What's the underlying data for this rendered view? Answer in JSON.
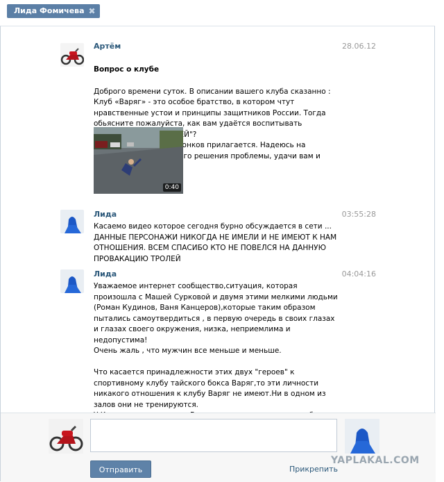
{
  "dialog_tab": {
    "name": "Лида Фомичева",
    "close": "✖"
  },
  "messages": [
    {
      "author": "Артём",
      "time": "28.06.12",
      "subject": "Вопрос о клубе",
      "text": "Доброго времени суток. В описании вашего клуба сказанно : Клуб «Варяг» - это особое братство, в котором чтут нравственные устои и принципы защитников России. Тогда обьясните пожалуйста, как вам удаётся воспитывать подобных \"ВЫКИДЫШЕЙ\"?\nВидео и ссылка на падонков прилагается. Надеюсь на понимание и скорейшего решения проблемы, удачи вам и вашему клубу.",
      "video_duration": "0:40"
    },
    {
      "author": "Лида",
      "time": "03:55:28",
      "text": "Касаемо видео которое сегодня бурно обсуждается в сети ...\nДАННЫЕ ПЕРСОНАЖИ НИКОГДА НЕ ИМЕЛИ И НЕ ИМЕЮТ К НАМ ОТНОШЕНИЯ. ВСЕМ СПАСИБО КТО НЕ ПОВЕЛСЯ НА ДАННУЮ ПРОВАКАЦИЮ ТРОЛЕЙ"
    },
    {
      "author": "Лида",
      "time": "04:04:16",
      "text": "Уважаемое интернет сообщество,ситуация, которая произошла с Машей Сурковой и двумя этими мелкими людьми\n(Роман Кудинов, Ваня Канцеров),которые таким образом пытались самоутвердиться , в первую очередь в своих глазах и глазах своего окружения, низка, неприемлима и недопустима!\nОчень жаль , что мужчин все меньше и меньше.\n\nЧто касается принадлежности этих двух \"героев\" к спортивному клубу тайского бокса Варяг,то эти личности никакого отношения к клубу Варяг не имеют.Ни в одном из залов они не тренируются.\nУ Кудинова на странице Вконтакте, есть ссылка на клуб Варяг,он являлся виртуальным участником группы,и не более\n(из группы удален)."
    }
  ],
  "composer": {
    "text_value": "",
    "send_label": "Отправить",
    "attach_label": "Прикрепить"
  },
  "watermark": "YAPLAKAL.COM",
  "colors": {
    "accent": "#5e82a8",
    "link": "#2b587a",
    "time": "#999999"
  }
}
